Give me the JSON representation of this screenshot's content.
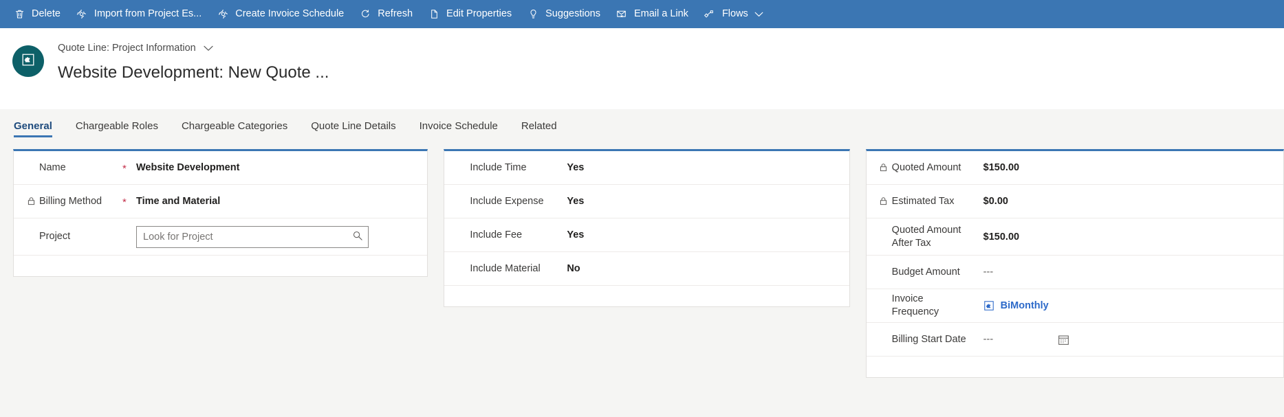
{
  "commandbar": {
    "background": "#3b76b3",
    "items": [
      {
        "label": "Delete",
        "icon": "trash-icon",
        "chevron": false
      },
      {
        "label": "Import from Project Es...",
        "icon": "settings-gear-icon",
        "chevron": false
      },
      {
        "label": "Create Invoice Schedule",
        "icon": "settings-gear-icon",
        "chevron": false
      },
      {
        "label": "Refresh",
        "icon": "refresh-icon",
        "chevron": false
      },
      {
        "label": "Edit Properties",
        "icon": "page-edit-icon",
        "chevron": false
      },
      {
        "label": "Suggestions",
        "icon": "lightbulb-icon",
        "chevron": false
      },
      {
        "label": "Email a Link",
        "icon": "email-link-icon",
        "chevron": false
      },
      {
        "label": "Flows",
        "icon": "flows-icon",
        "chevron": true
      }
    ]
  },
  "header": {
    "avatar_icon": "puzzle-entity-icon",
    "avatar_color": "#0d6068",
    "breadcrumb": "Quote Line: Project Information",
    "breadcrumb_chevron": "chevron-down-icon",
    "title": "Website Development: New Quote ..."
  },
  "tabs": {
    "active_index": 0,
    "items": [
      {
        "label": "General"
      },
      {
        "label": "Chargeable Roles"
      },
      {
        "label": "Chargeable Categories"
      },
      {
        "label": "Quote Line Details"
      },
      {
        "label": "Invoice Schedule"
      },
      {
        "label": "Related"
      }
    ]
  },
  "cards": {
    "accent_color": "#3b76b3",
    "left": {
      "fields": [
        {
          "label": "Name",
          "required": true,
          "locked": false,
          "value": "Website Development",
          "type": "text"
        },
        {
          "label": "Billing Method",
          "required": true,
          "locked": true,
          "value": "Time and Material",
          "type": "text"
        },
        {
          "label": "Project",
          "required": false,
          "locked": false,
          "value": "",
          "placeholder": "Look for Project",
          "type": "lookup",
          "lookup_icon": "search-icon"
        }
      ]
    },
    "middle": {
      "fields": [
        {
          "label": "Include Time",
          "required": false,
          "locked": false,
          "value": "Yes",
          "type": "text"
        },
        {
          "label": "Include Expense",
          "required": false,
          "locked": false,
          "value": "Yes",
          "type": "text"
        },
        {
          "label": "Include Fee",
          "required": false,
          "locked": false,
          "value": "Yes",
          "type": "text"
        },
        {
          "label": "Include Material",
          "required": false,
          "locked": false,
          "value": "No",
          "type": "text"
        }
      ]
    },
    "right": {
      "fields": [
        {
          "label": "Quoted Amount",
          "required": false,
          "locked": true,
          "value": "$150.00",
          "type": "text"
        },
        {
          "label": "Estimated Tax",
          "required": false,
          "locked": true,
          "value": "$0.00",
          "type": "text"
        },
        {
          "label": "Quoted Amount After Tax",
          "label_line1": "Quoted Amount",
          "label_line2": "After Tax",
          "required": false,
          "locked": false,
          "value": "$150.00",
          "type": "text"
        },
        {
          "label": "Budget Amount",
          "required": false,
          "locked": false,
          "value": "---",
          "type": "empty"
        },
        {
          "label": "Invoice Frequency",
          "required": false,
          "locked": false,
          "value": "BiMonthly",
          "type": "link",
          "value_icon": "puzzle-entity-icon",
          "value_color": "#2d6ac9"
        },
        {
          "label": "Billing Start Date",
          "required": false,
          "locked": false,
          "value": "---",
          "type": "date",
          "date_icon": "calendar-icon"
        }
      ]
    }
  }
}
